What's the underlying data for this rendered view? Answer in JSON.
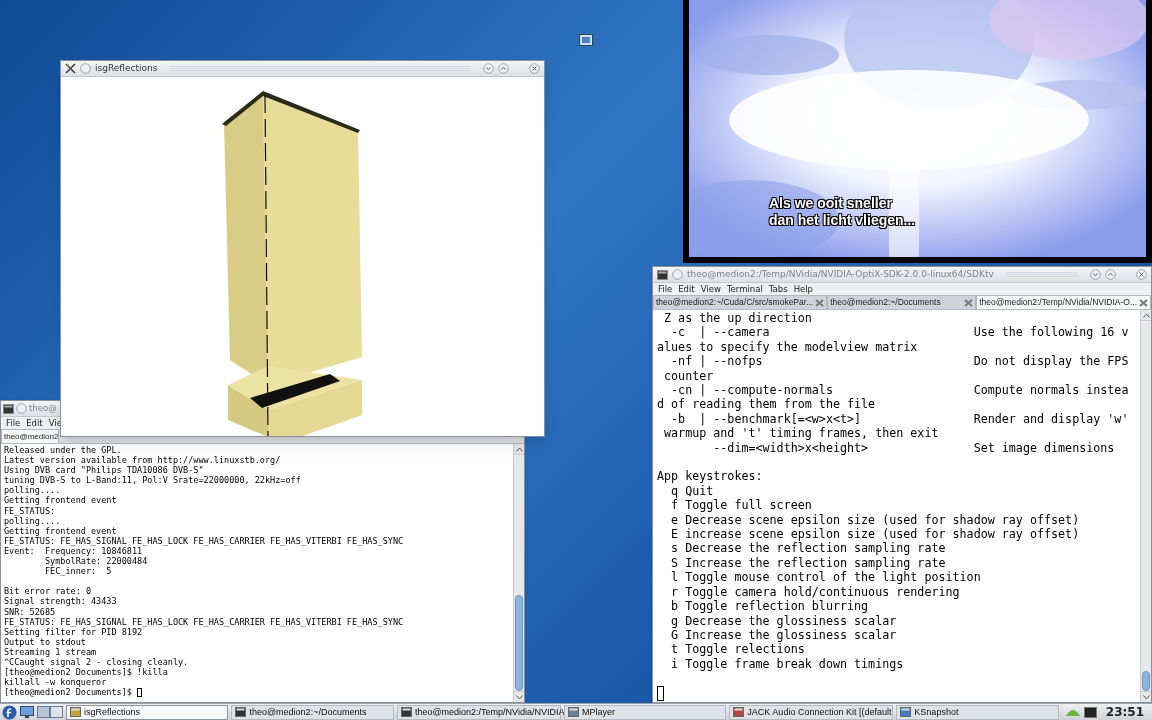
{
  "reflections_window": {
    "title": "isgReflections"
  },
  "left_terminal": {
    "title": "theo@",
    "menu": [
      "File",
      "Edit",
      "Vie"
    ],
    "tabs": [
      {
        "label": "theo@medion2",
        "selected": true
      }
    ],
    "blocks": [
      [
        "Released under the GPL.",
        "Latest version available from http://www.linuxstb.org/",
        "Using DVB card \"Philips TDA10086 DVB-S\"",
        "tuning DVB-S to L-Band:11, Pol:V Srate=22000000, 22kHz=off",
        "polling....",
        "Getting frontend event",
        "FE_STATUS:",
        "polling....",
        "Getting frontend event",
        "FE_STATUS: FE_HAS_SIGNAL FE_HAS_LOCK FE_HAS_CARRIER FE_HAS_VITERBI FE_HAS_SYNC",
        "Event:  Frequency: 10846811",
        "        SymbolRate: 22000484",
        "        FEC_inner:  5"
      ],
      [
        "Bit error rate: 0",
        "Signal strength: 43433",
        "SNR: 52685",
        "FE_STATUS: FE_HAS_SIGNAL FE_HAS_LOCK FE_HAS_CARRIER FE_HAS_VITERBI FE_HAS_SYNC",
        "Setting filter for PID 8192",
        "Output to stdout",
        "Streaming 1 stream",
        "^CCaught signal 2 - closing cleanly.",
        "[theo@medion2 Documents]$ !killa",
        "killall -w konqueror",
        "[theo@medion2 Documents]$"
      ]
    ]
  },
  "media_player": {
    "subtitles": [
      "Als we ooit sneller",
      "dan het licht vliegen..."
    ]
  },
  "right_terminal": {
    "title": "theo@medion2:/Temp/NVidia/NVIDIA-OptiX-SDK-2.0.0-linux64/SDKtv",
    "menu": [
      "File",
      "Edit",
      "View",
      "Terminal",
      "Tabs",
      "Help"
    ],
    "tabs": [
      {
        "label": "theo@medion2:~/Cuda/C/src/smokePar...",
        "selected": false
      },
      {
        "label": "theo@medion2:~/Documents",
        "selected": false
      },
      {
        "label": "theo@medion2:/Temp/NVidia/NVIDIA-O...",
        "selected": true
      }
    ],
    "blocks": [
      [
        {
          "kind": "text",
          "text": " Z as the up direction"
        },
        {
          "kind": "option",
          "option": "  -c  | --camera",
          "description": "Use the following 16 v"
        },
        {
          "kind": "text",
          "text": "alues to specify the modelview matrix"
        },
        {
          "kind": "option",
          "option": "  -nf | --nofps",
          "description": "Do not display the FPS"
        },
        {
          "kind": "text",
          "text": " counter"
        },
        {
          "kind": "option",
          "option": "  -cn | --compute-normals",
          "description": "Compute normals instea"
        },
        {
          "kind": "text",
          "text": "d of reading them from the file"
        },
        {
          "kind": "option",
          "option": "  -b  | --benchmark[=<w>x<t>]",
          "description": "Render and display 'w'"
        },
        {
          "kind": "text",
          "text": " warmup and 't' timing frames, then exit"
        },
        {
          "kind": "option",
          "option": "        --dim=<width>x<height>",
          "description": "Set image dimensions"
        }
      ],
      [
        {
          "kind": "text",
          "text": "App keystrokes:"
        },
        {
          "kind": "text",
          "text": "  q Quit"
        },
        {
          "kind": "text",
          "text": "  f Toggle full screen"
        },
        {
          "kind": "text",
          "text": "  e Decrease scene epsilon size (used for shadow ray offset)"
        },
        {
          "kind": "text",
          "text": "  E increase scene epsilon size (used for shadow ray offset)"
        },
        {
          "kind": "text",
          "text": "  s Decrease the reflection sampling rate"
        },
        {
          "kind": "text",
          "text": "  S Increase the reflection sampling rate"
        },
        {
          "kind": "text",
          "text": "  l Toggle mouse control of the light position"
        },
        {
          "kind": "text",
          "text": "  r Toggle camera hold/continuous rendering"
        },
        {
          "kind": "text",
          "text": "  b Toggle reflection blurring"
        },
        {
          "kind": "text",
          "text": "  g Decrease the glossiness scalar"
        },
        {
          "kind": "text",
          "text": "  G Increase the glossiness scalar"
        },
        {
          "kind": "text",
          "text": "  t Toggle relections"
        },
        {
          "kind": "text",
          "text": "  i Toggle frame break down timings"
        }
      ]
    ]
  },
  "taskbar": {
    "tasks": [
      {
        "label": "isgReflections",
        "selected": true
      },
      {
        "label": "theo@medion2:~/Documents",
        "selected": false
      },
      {
        "label": "theo@medion2:/Temp/NVidia/NVIDIA",
        "selected": false
      },
      {
        "label": "MPlayer",
        "selected": false
      },
      {
        "label": "JACK Audio Connection Kit [(default",
        "selected": false
      },
      {
        "label": "KSnapshot",
        "selected": false
      }
    ],
    "clock": "23:51"
  }
}
